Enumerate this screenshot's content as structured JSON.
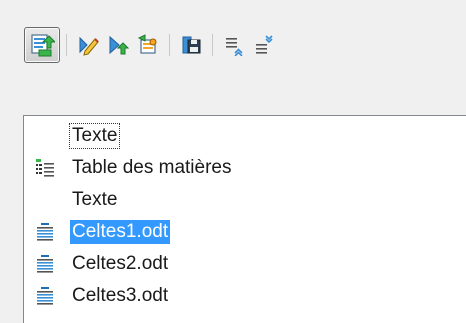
{
  "toolbar": {
    "buttons": [
      {
        "icon": "navigator-toggle-icon",
        "active": true
      },
      {
        "icon": "edit-icon"
      },
      {
        "icon": "move-up-icon"
      },
      {
        "icon": "insert-icon"
      },
      {
        "icon": "save-contents-icon"
      },
      {
        "icon": "promote-level-icon"
      },
      {
        "icon": "demote-level-icon"
      }
    ]
  },
  "tree": {
    "items": [
      {
        "label": "Texte",
        "icon": null,
        "focused": true,
        "selected": false
      },
      {
        "label": "Table des matières",
        "icon": "index-icon",
        "focused": false,
        "selected": false
      },
      {
        "label": "Texte",
        "icon": null,
        "focused": false,
        "selected": false
      },
      {
        "label": "Celtes1.odt",
        "icon": "file-icon",
        "focused": false,
        "selected": true
      },
      {
        "label": "Celtes2.odt",
        "icon": "file-icon",
        "focused": false,
        "selected": false
      },
      {
        "label": "Celtes3.odt",
        "icon": "file-icon",
        "focused": false,
        "selected": false
      }
    ]
  },
  "colors": {
    "selection": "#3399ff",
    "panel_bg": "#ffffff",
    "window_bg": "#f0f0f0"
  }
}
